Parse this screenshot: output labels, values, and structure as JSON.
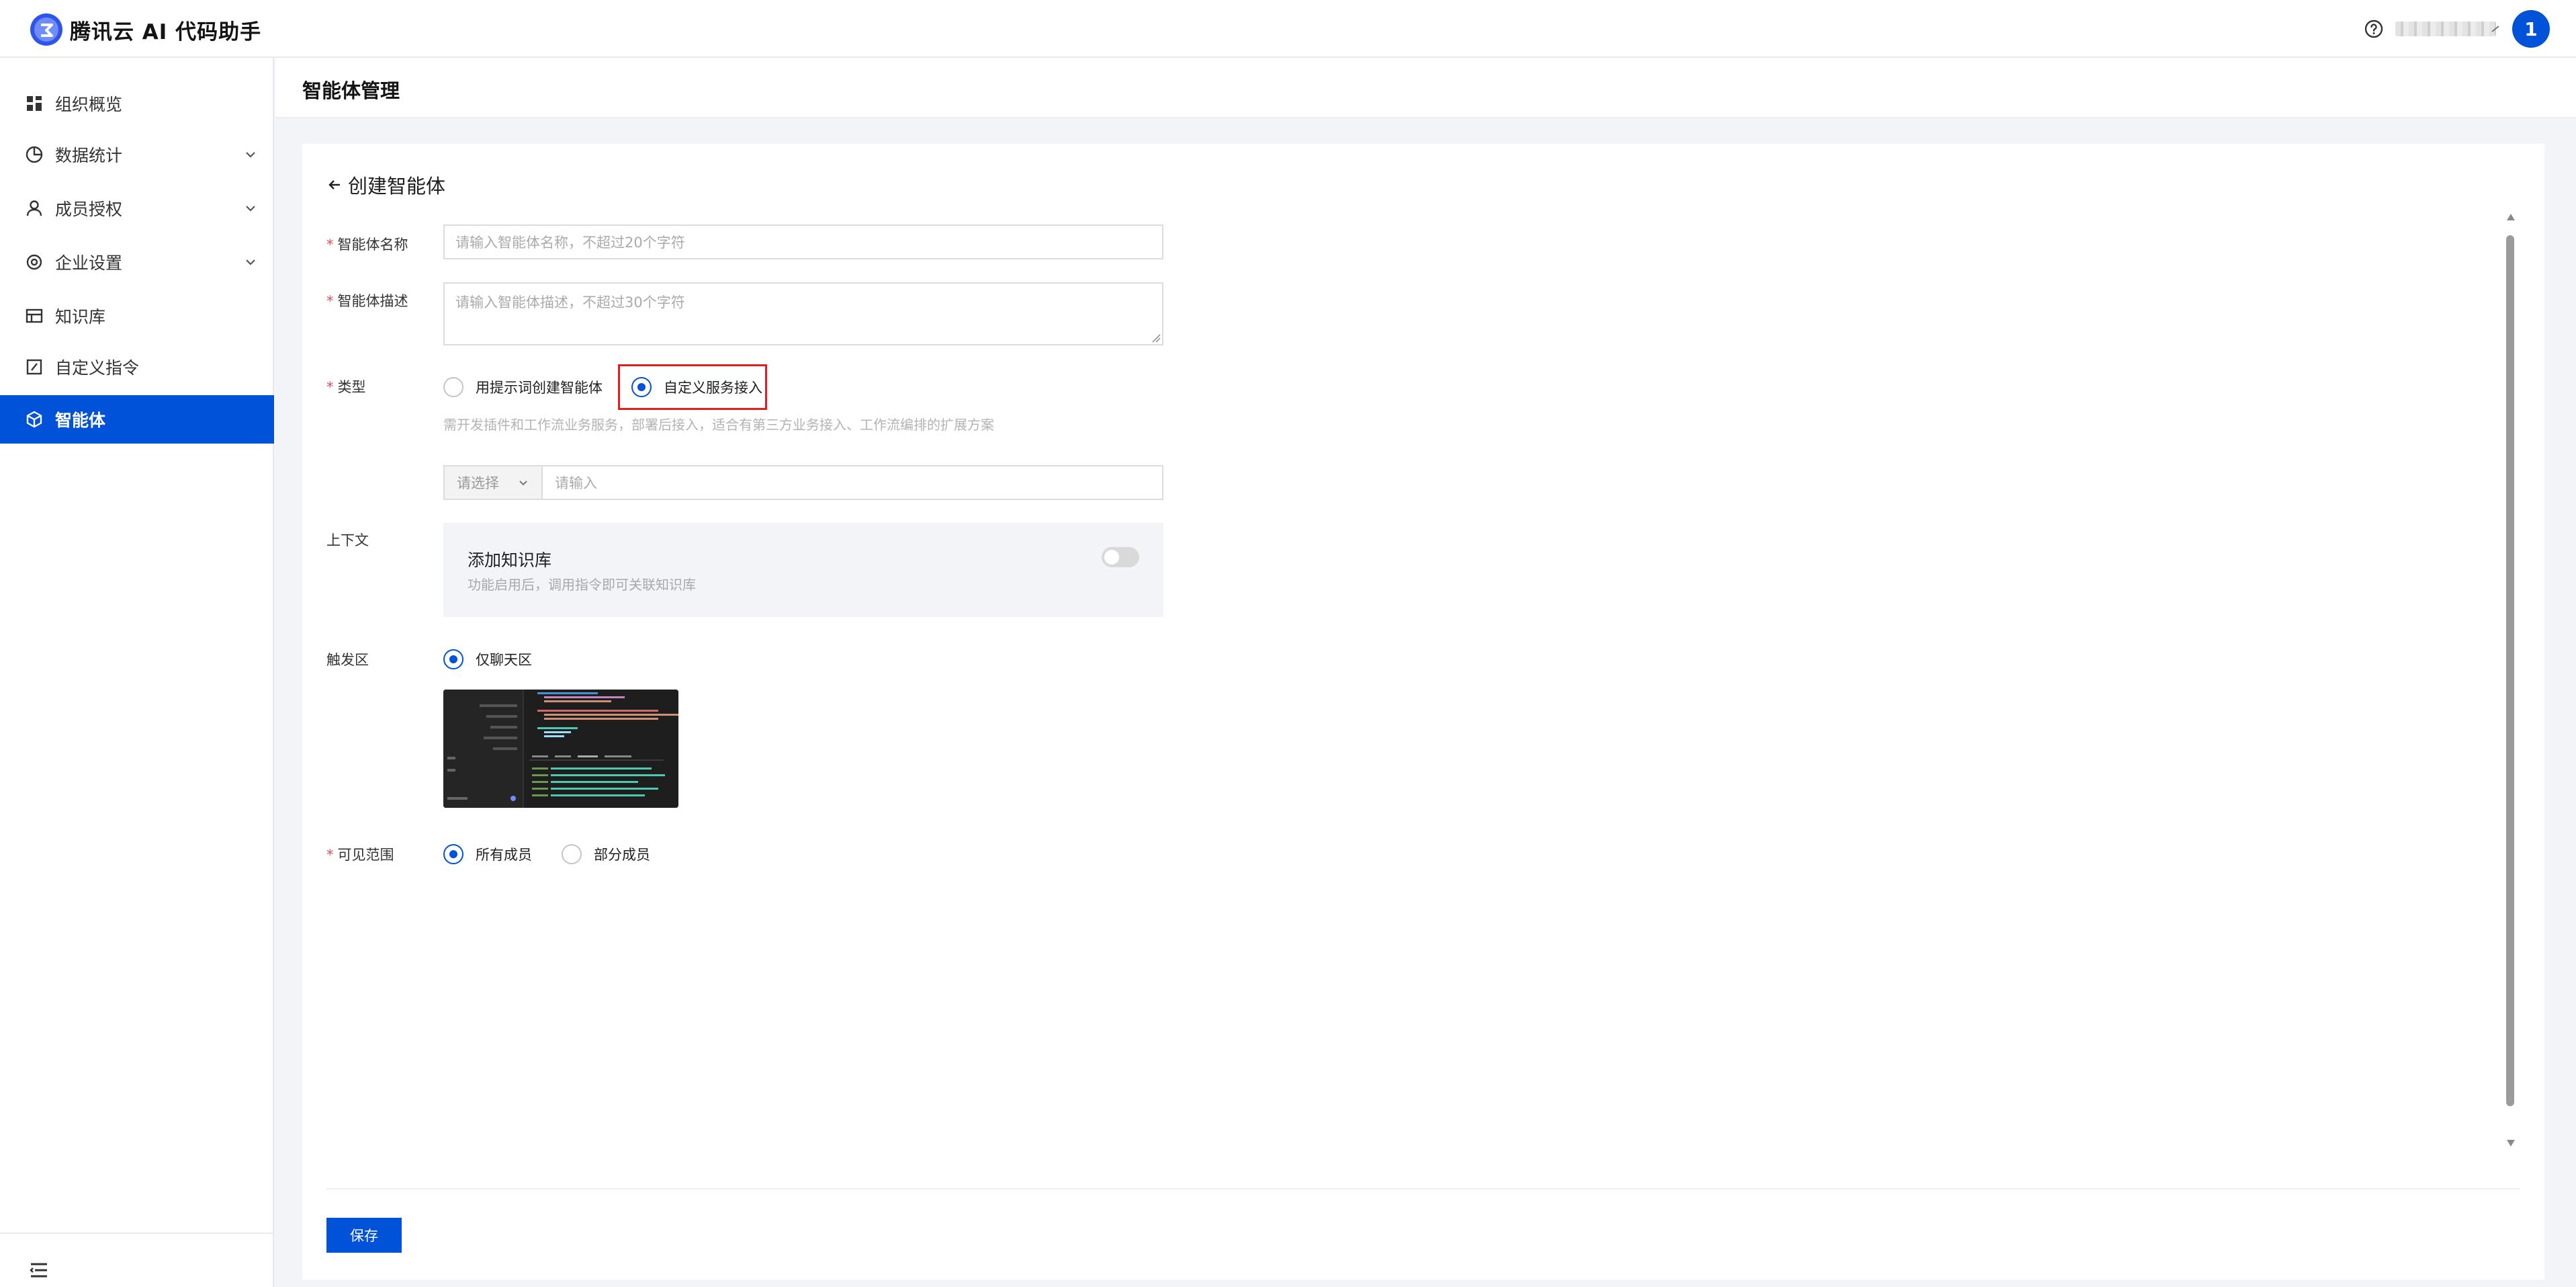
{
  "app": {
    "title": "腾讯云 AI 代码助手",
    "avatar_text": "1",
    "accent_color": "#0052d9"
  },
  "sidebar": {
    "items": [
      {
        "label": "组织概览",
        "icon": "dashboard-icon",
        "expandable": false,
        "active": false
      },
      {
        "label": "数据统计",
        "icon": "pie-chart-icon",
        "expandable": true,
        "active": false
      },
      {
        "label": "成员授权",
        "icon": "user-icon",
        "expandable": true,
        "active": false
      },
      {
        "label": "企业设置",
        "icon": "settings-icon",
        "expandable": true,
        "active": false
      },
      {
        "label": "知识库",
        "icon": "knowledge-base-icon",
        "expandable": false,
        "active": false
      },
      {
        "label": "自定义指令",
        "icon": "edit-command-icon",
        "expandable": false,
        "active": false
      },
      {
        "label": "智能体",
        "icon": "agent-cube-icon",
        "expandable": false,
        "active": true
      }
    ]
  },
  "header": {
    "page_title": "智能体管理"
  },
  "form": {
    "back_label": "创建智能体",
    "name": {
      "label": "智能体名称",
      "placeholder": "请输入智能体名称，不超过20个字符",
      "value": ""
    },
    "description": {
      "label": "智能体描述",
      "placeholder": "请输入智能体描述，不超过30个字符",
      "value": ""
    },
    "type": {
      "label": "类型",
      "options": [
        "用提示词创建智能体",
        "自定义服务接入"
      ],
      "selected": "自定义服务接入",
      "hint": "需开发插件和工作流业务服务，部署后接入，适合有第三方业务接入、工作流编排的扩展方案"
    },
    "service": {
      "select_placeholder": "请选择",
      "input_placeholder": "请输入"
    },
    "context": {
      "label": "上下文",
      "kb_title": "添加知识库",
      "kb_desc": "功能启用后，调用指令即可关联知识库",
      "kb_enabled": false
    },
    "trigger": {
      "label": "触发区",
      "option": "仅聊天区",
      "selected": true
    },
    "visibility": {
      "label": "可见范围",
      "options": [
        "所有成员",
        "部分成员"
      ],
      "selected": "所有成员"
    },
    "save_label": "保存"
  }
}
